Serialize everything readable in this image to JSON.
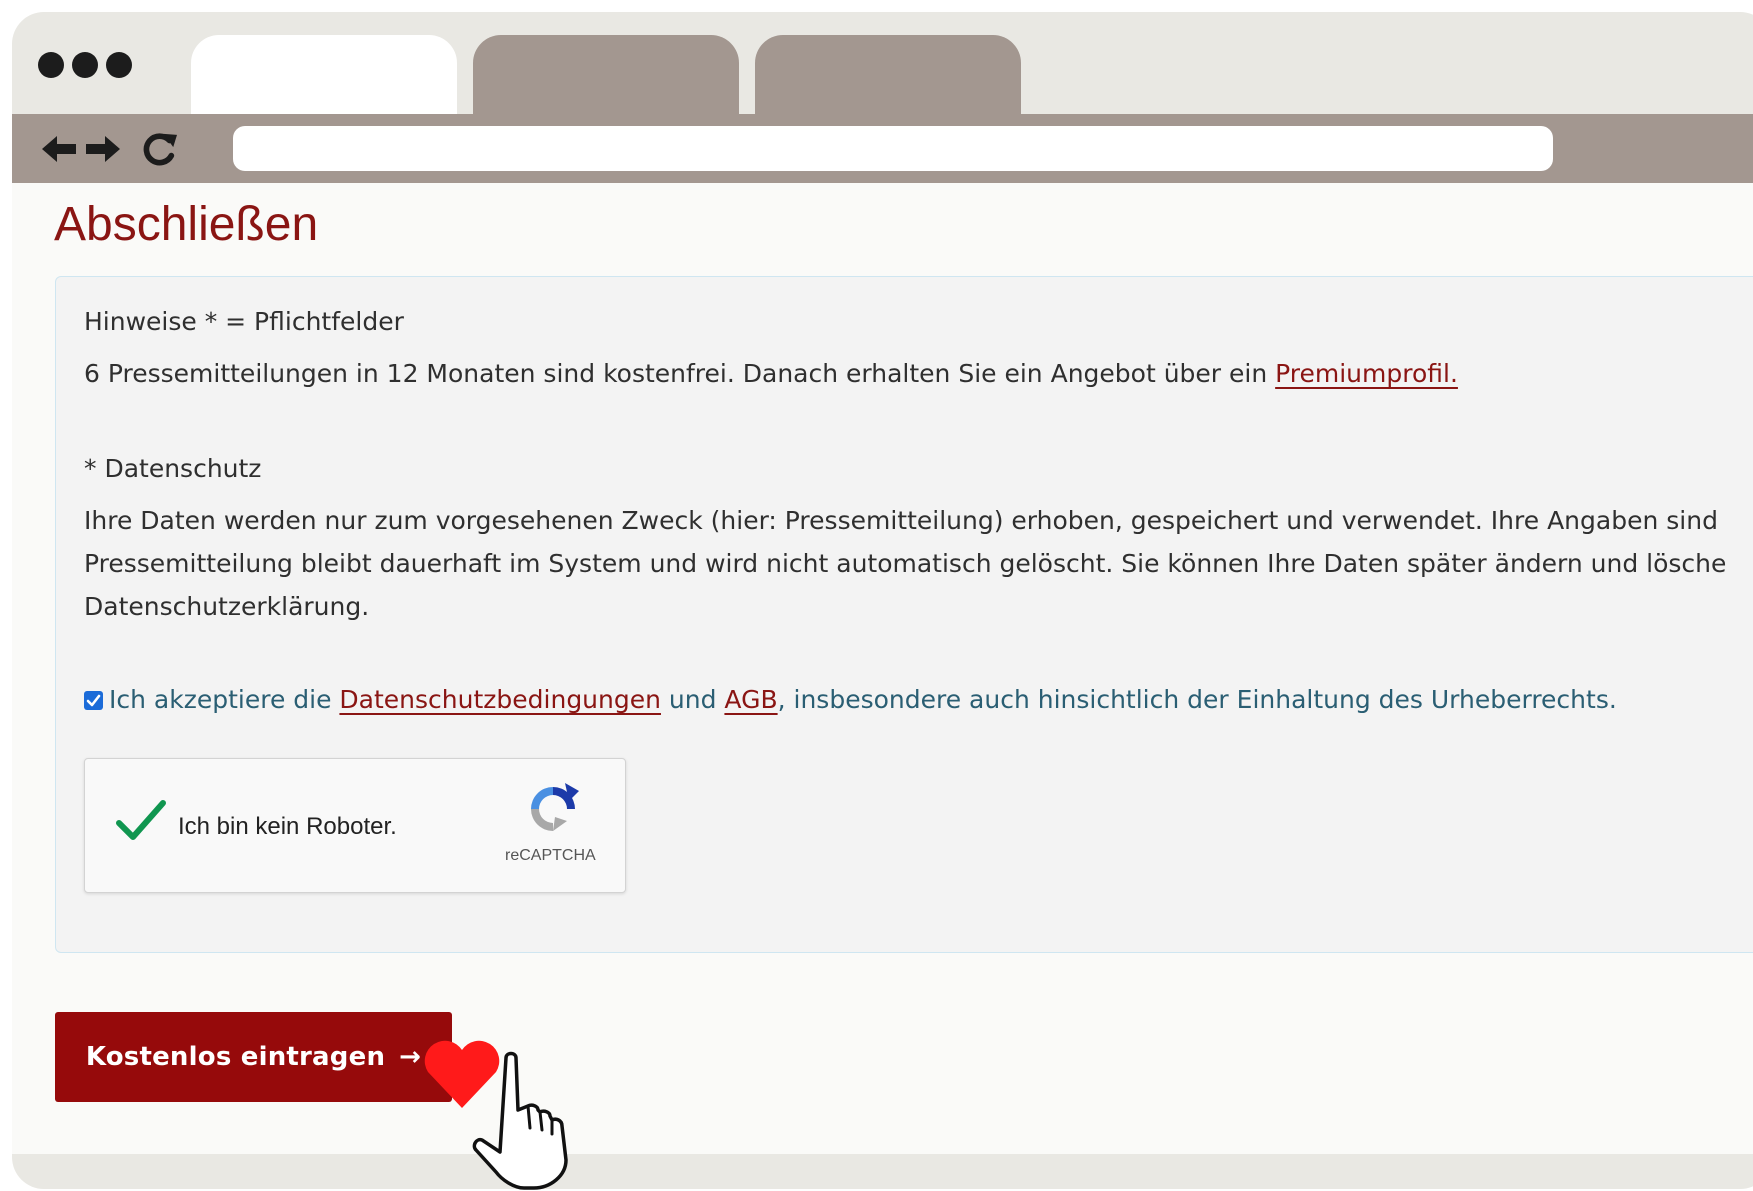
{
  "browser": {
    "address_url": ""
  },
  "page": {
    "title": "Abschließen"
  },
  "notes": {
    "required_hint": "Hinweise * = Pflichtfelder",
    "free_info_text": "6 Pressemitteilungen in 12 Monaten sind kostenfrei. Danach erhalten Sie ein Angebot über ein ",
    "premium_link": "Premiumprofil.",
    "privacy_heading": "* Datenschutz",
    "privacy_line_1": "Ihre Daten werden nur zum vorgesehenen Zweck (hier: Pressemitteilung) erhoben, gespeichert und verwendet. Ihre Angaben sind",
    "privacy_line_2": "Pressemitteilung bleibt dauerhaft im System und wird nicht automatisch gelöscht. Sie können Ihre Daten später ändern und lösche",
    "privacy_line_3": "Datenschutzerklärung."
  },
  "consent": {
    "checked": true,
    "prefix": "Ich akzeptiere die ",
    "privacy_link": "Datenschutzbedingungen",
    "middle": " und ",
    "terms_link": "AGB",
    "suffix": ", insbesondere auch hinsichtlich der Einhaltung des Urheberrechts."
  },
  "captcha": {
    "label": "Ich bin kein Roboter.",
    "brand": "reCAPTCHA",
    "verified": true
  },
  "submit": {
    "label": "Kostenlos eintragen",
    "arrow": "→"
  },
  "colors": {
    "brand_red": "#960a0b",
    "title_red": "#8a1513",
    "browser_chrome": "#a39790",
    "consent_text": "#2a5e73",
    "heart": "#ff1a1a"
  },
  "icons": [
    "back-arrow-icon",
    "forward-arrow-icon",
    "reload-icon",
    "checkmark-icon",
    "recaptcha-logo-icon",
    "heart-icon",
    "pointing-hand-icon"
  ]
}
